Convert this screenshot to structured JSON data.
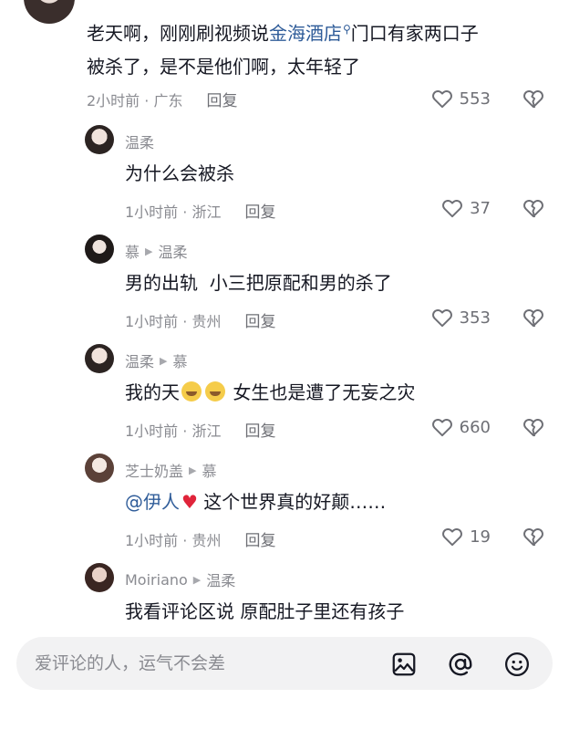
{
  "comments": [
    {
      "text_prefix": "老天啊，刚刚刷视频说",
      "text_highlight": "金海酒店",
      "text_suffix_line1": "门口有家两口子",
      "text_line2": "被杀了，是不是他们啊，太年轻了",
      "time_location": "2小时前 · 广东",
      "reply_label": "回复",
      "likes": "553"
    }
  ],
  "replies": [
    {
      "author": "温柔",
      "reply_to": "",
      "text": "为什么会被杀",
      "time_location": "1小时前 · 浙江",
      "reply_label": "回复",
      "likes": "37"
    },
    {
      "author": "慕",
      "reply_to": "温柔",
      "text": "男的出轨  小三把原配和男的杀了",
      "time_location": "1小时前 · 贵州",
      "reply_label": "回复",
      "likes": "353"
    },
    {
      "author": "温柔",
      "reply_to": "慕",
      "text_before": "我的天",
      "text_after": " 女生也是遭了无妄之灾",
      "time_location": "1小时前 · 浙江",
      "reply_label": "回复",
      "likes": "660"
    },
    {
      "author": "芝士奶盖",
      "reply_to": "慕",
      "mention": "@伊人",
      "text_after": " 这个世界真的好颠……",
      "time_location": "1小时前 · 贵州",
      "reply_label": "回复",
      "likes": "19"
    },
    {
      "author": "Moiriano",
      "reply_to": "温柔",
      "text": "我看评论区说 原配肚子里还有孩子"
    }
  ],
  "input": {
    "placeholder": "爱评论的人，运气不会差"
  },
  "icons": {
    "like": "heart-outline-icon",
    "dislike": "broken-heart-icon",
    "image": "image-icon",
    "at": "at-sign-icon",
    "emoji": "smiley-icon",
    "search": "search-icon",
    "arrow": "triangle-right-icon"
  },
  "colors": {
    "link": "#2f5c99",
    "muted": "#8a8b91",
    "text": "#161823",
    "heart": "#e0243a"
  }
}
